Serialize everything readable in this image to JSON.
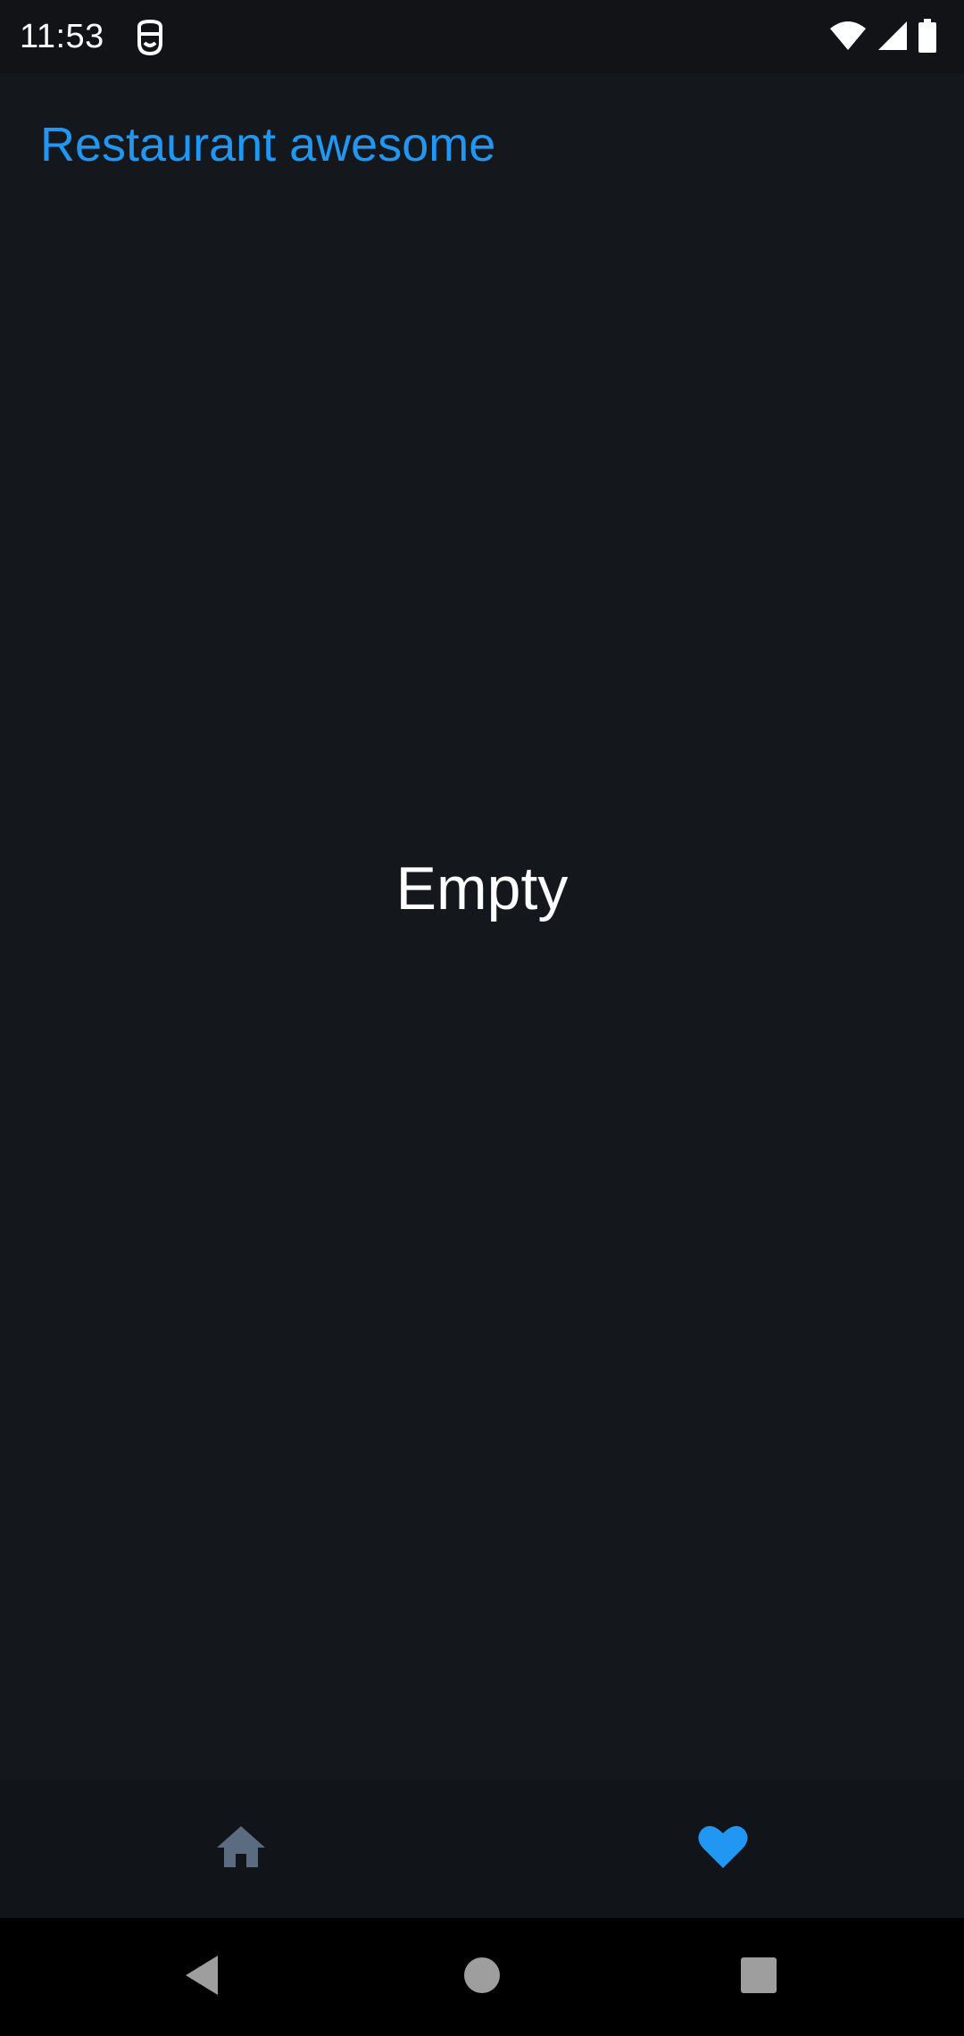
{
  "status_bar": {
    "time": "11:53",
    "icons": [
      "app-notification-icon",
      "wifi-icon",
      "cell-signal-icon",
      "battery-icon"
    ]
  },
  "app_bar": {
    "title": "Restaurant awesome"
  },
  "main": {
    "empty_message": "Empty"
  },
  "bottom_nav": {
    "items": [
      {
        "icon": "home-icon",
        "selected": false
      },
      {
        "icon": "heart-icon",
        "selected": true
      }
    ]
  },
  "system_nav": {
    "buttons": [
      "back",
      "home",
      "recents"
    ]
  },
  "colors": {
    "accent": "#2196f3",
    "background": "#14181d",
    "inactive_icon": "#5b6b80",
    "text": "#ffffff"
  }
}
